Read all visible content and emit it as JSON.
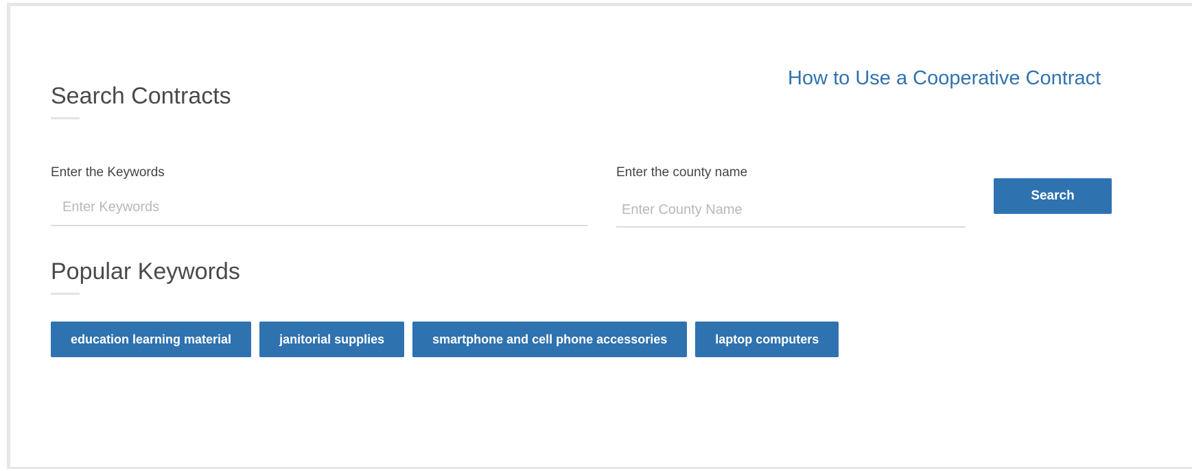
{
  "search_section": {
    "title": "Search Contracts"
  },
  "help_link": {
    "label": "How to Use a Cooperative Contract"
  },
  "keywords_field": {
    "label": "Enter the Keywords",
    "placeholder": "Enter Keywords",
    "value": ""
  },
  "county_field": {
    "label": "Enter the county name",
    "placeholder": "Enter County Name",
    "value": ""
  },
  "search_button": {
    "label": "Search"
  },
  "popular_section": {
    "title": "Popular Keywords",
    "keywords": [
      "education learning material",
      "janitorial supplies",
      "smartphone and cell phone accessories",
      "laptop computers"
    ]
  },
  "colors": {
    "accent": "#2f72b0",
    "link": "#3172ad",
    "heading": "#4a4a4a"
  }
}
